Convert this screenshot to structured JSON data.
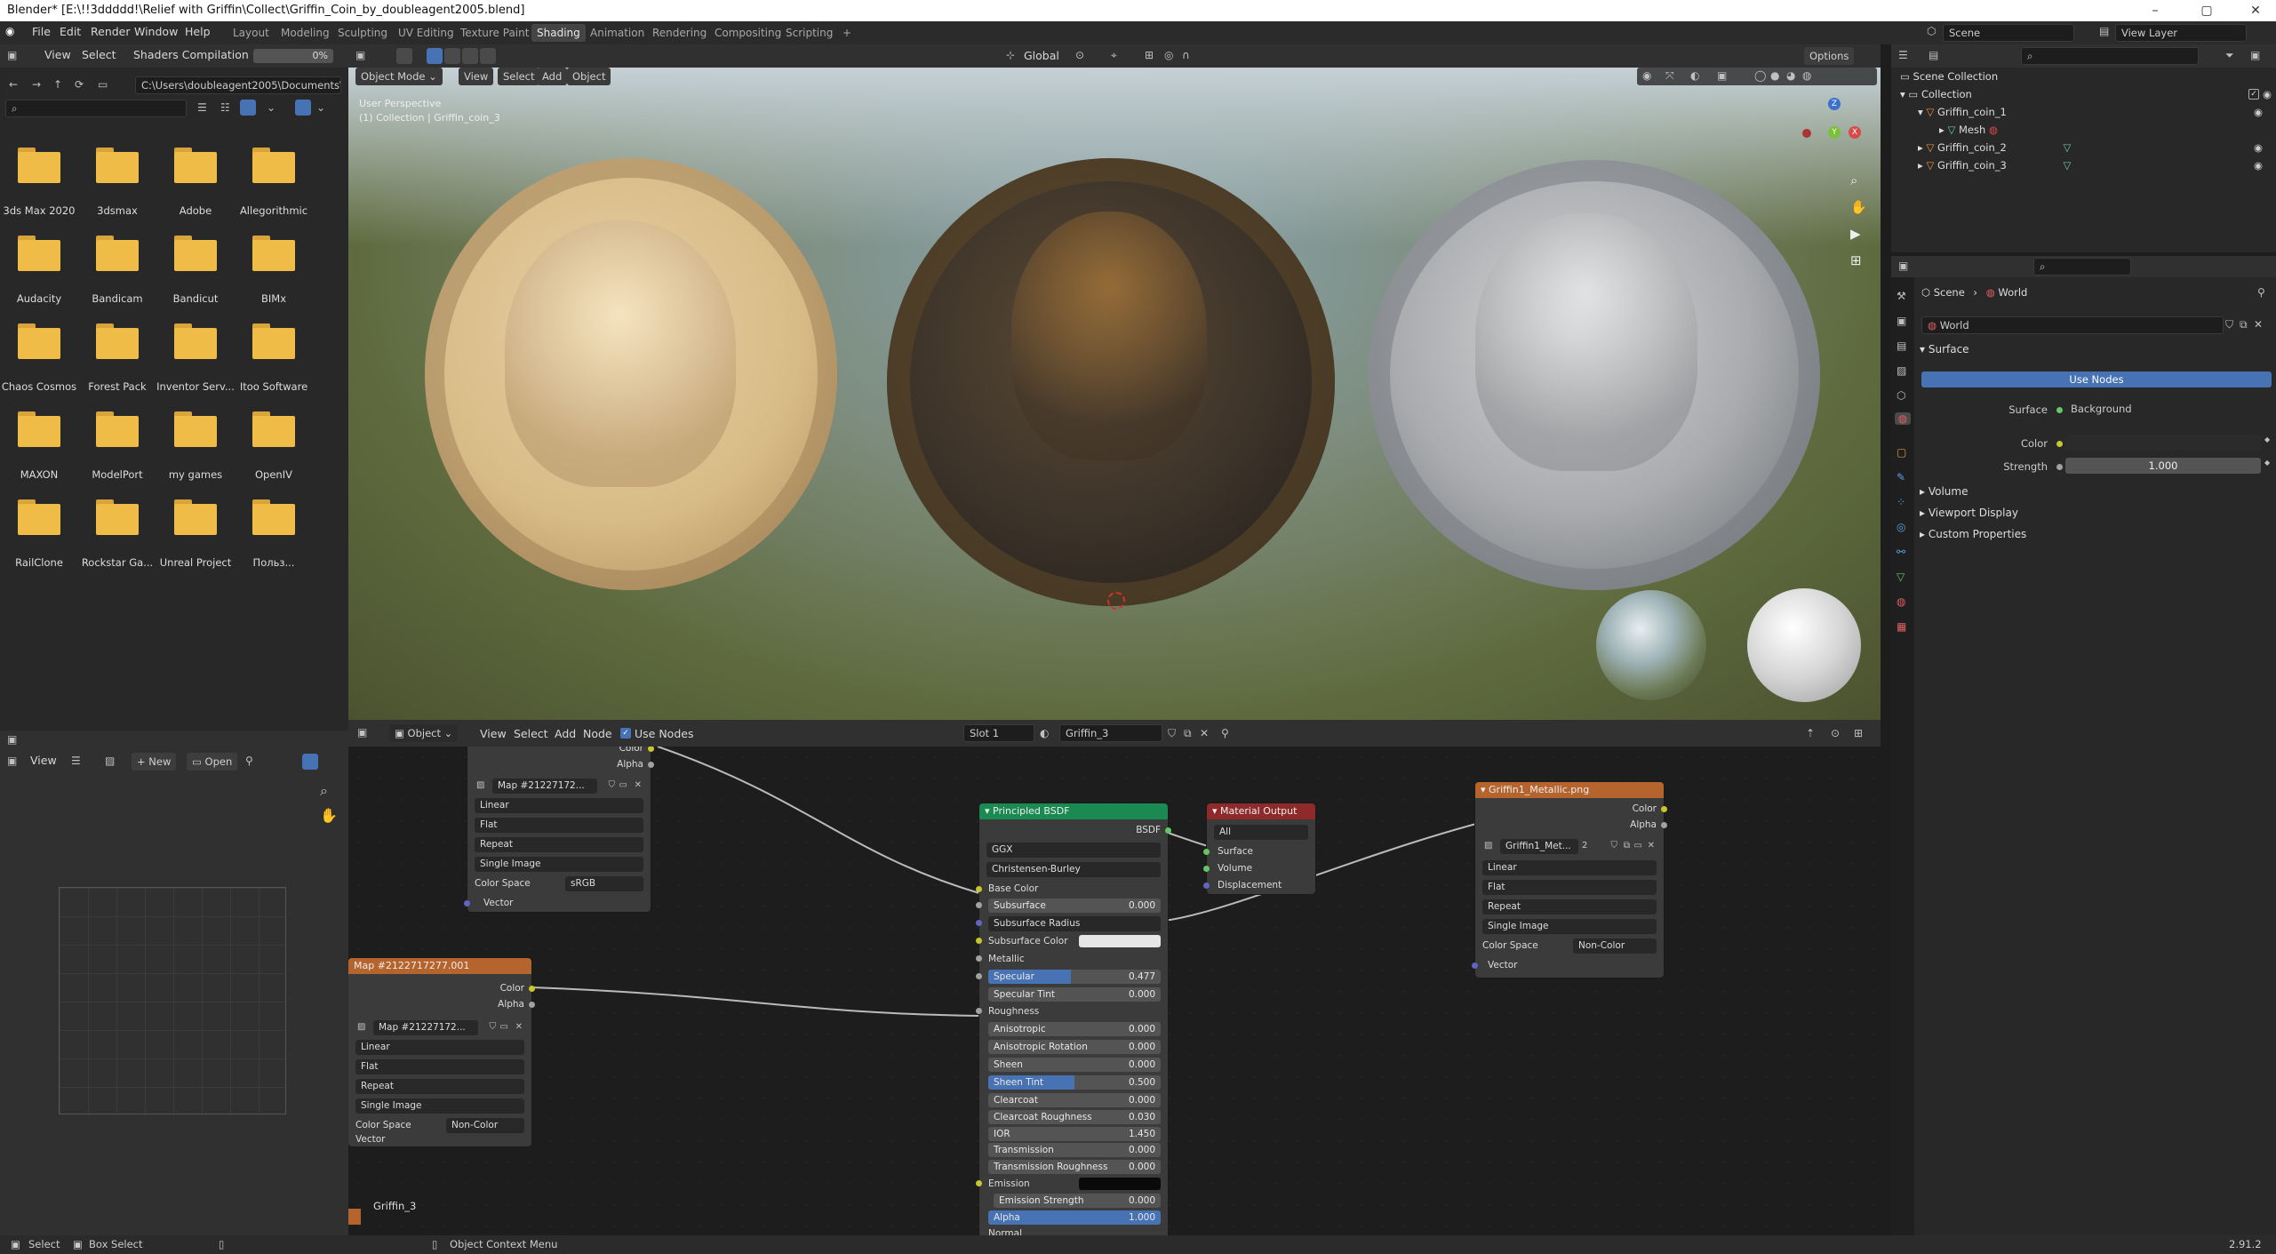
{
  "window": {
    "title": "Blender* [E:\\!!3ddddd!\\Relief with Griffin\\Collect\\Griffin_Coin_by_doubleagent2005.blend]",
    "minimize": "–",
    "maximize": "▢",
    "close": "✕"
  },
  "menubar": {
    "items": [
      "File",
      "Edit",
      "Render",
      "Window",
      "Help"
    ]
  },
  "workspaces": {
    "tabs": [
      "Layout",
      "Modeling",
      "Sculpting",
      "UV Editing",
      "Texture Paint",
      "Shading",
      "Animation",
      "Rendering",
      "Compositing",
      "Scripting"
    ],
    "active": "Shading",
    "add": "+"
  },
  "scene": {
    "name": "Scene",
    "view_layer": "View Layer"
  },
  "filebrowser": {
    "menus": [
      "View",
      "Select"
    ],
    "title": "Shaders Compilation",
    "progress_text": "0%",
    "progress": 0,
    "path": "C:\\Users\\doubleagent2005\\Documents\\",
    "folders": [
      "3ds Max 2020",
      "3dsmax",
      "Adobe",
      "Allegorithmic",
      "Audacity",
      "Bandicam",
      "Bandicut",
      "BIMx",
      "Chaos Cosmos",
      "Forest Pack",
      "Inventor Serv...",
      "Itoo Software",
      "MAXON",
      "ModelPort",
      "my games",
      "OpenIV",
      "RailClone",
      "Rockstar Ga...",
      "Unreal Project",
      "Польз..."
    ]
  },
  "viewport": {
    "mode": "Object Mode",
    "menus": [
      "View",
      "Select",
      "Add",
      "Object"
    ],
    "transform": "Global",
    "overlay_text1": "User Perspective",
    "overlay_text2": "(1) Collection | Griffin_coin_3",
    "options": "Options",
    "gizmo": {
      "x": "X",
      "y": "Y",
      "z": "Z"
    }
  },
  "image_editor": {
    "view": "View",
    "new": "New",
    "open": "Open"
  },
  "node_editor": {
    "type": "Object",
    "menus": [
      "View",
      "Select",
      "Add",
      "Node"
    ],
    "use_nodes": "Use Nodes",
    "slot": "Slot 1",
    "material": "Griffin_3",
    "footer_label": "Griffin_3",
    "node_map1": {
      "outputs": [
        "Color",
        "Alpha"
      ],
      "image": "Map #21227172...",
      "interp": "Linear",
      "proj": "Flat",
      "ext": "Repeat",
      "source": "Single Image",
      "cs_label": "Color Space",
      "cs": "sRGB",
      "vector": "Vector"
    },
    "node_map2": {
      "title": "Map #2122717277.001",
      "outputs": [
        "Color",
        "Alpha"
      ],
      "image": "Map #21227172...",
      "interp": "Linear",
      "proj": "Flat",
      "ext": "Repeat",
      "source": "Single Image",
      "cs_label": "Color Space",
      "cs": "Non-Color",
      "vector": "Vector"
    },
    "bsdf": {
      "title": "Principled BSDF",
      "output": "BSDF",
      "dist": "GGX",
      "ss_method": "Christensen-Burley",
      "base_color": "Base Color",
      "subsurface": {
        "label": "Subsurface",
        "value": "0.000"
      },
      "ss_radius": "Subsurface Radius",
      "ss_color": "Subsurface Color",
      "metallic": "Metallic",
      "specular": {
        "label": "Specular",
        "value": "0.477",
        "fill": 0.477
      },
      "spec_tint": {
        "label": "Specular Tint",
        "value": "0.000"
      },
      "roughness": "Roughness",
      "aniso": {
        "label": "Anisotropic",
        "value": "0.000"
      },
      "aniso_rot": {
        "label": "Anisotropic Rotation",
        "value": "0.000"
      },
      "sheen": {
        "label": "Sheen",
        "value": "0.000"
      },
      "sheen_tint": {
        "label": "Sheen Tint",
        "value": "0.500",
        "fill": 0.5
      },
      "clearcoat": {
        "label": "Clearcoat",
        "value": "0.000"
      },
      "cc_rough": {
        "label": "Clearcoat Roughness",
        "value": "0.030"
      },
      "ior": {
        "label": "IOR",
        "value": "1.450"
      },
      "transmission": {
        "label": "Transmission",
        "value": "0.000"
      },
      "trans_rough": {
        "label": "Transmission Roughness",
        "value": "0.000"
      },
      "emission": "Emission",
      "em_strength": {
        "label": "Emission Strength",
        "value": "0.000"
      },
      "alpha": {
        "label": "Alpha",
        "value": "1.000",
        "fill": 1
      },
      "normal": "Normal"
    },
    "mat_out": {
      "title": "Material Output",
      "target": "All",
      "inputs": [
        "Surface",
        "Volume",
        "Displacement"
      ]
    },
    "metal": {
      "title": "Griffin1_Metallic.png",
      "outputs": [
        "Color",
        "Alpha"
      ],
      "image": "Griffin1_Met...",
      "users": "2",
      "interp": "Linear",
      "proj": "Flat",
      "ext": "Repeat",
      "source": "Single Image",
      "cs_label": "Color Space",
      "cs": "Non-Color",
      "vector": "Vector"
    }
  },
  "outliner": {
    "root": "Scene Collection",
    "collection": "Collection",
    "items": [
      "Griffin_coin_1",
      "Mesh",
      "Griffin_coin_2",
      "Griffin_coin_3"
    ]
  },
  "properties": {
    "breadcrumb": [
      "Scene",
      "World"
    ],
    "world_name": "World",
    "surface_header": "Surface",
    "use_nodes": "Use Nodes",
    "surface_label": "Surface",
    "surface_value": "Background",
    "color_label": "Color",
    "strength_label": "Strength",
    "strength_value": "1.000",
    "sections": [
      "Volume",
      "Viewport Display",
      "Custom Properties"
    ]
  },
  "statusbar": {
    "select": "Select",
    "box_select": "Box Select",
    "context": "Object Context Menu",
    "version": "2.91.2"
  },
  "colors": {
    "accent": "#4772b3",
    "node_green": "#1a8a52",
    "node_red": "#8e2a2a",
    "node_orange": "#b5642d"
  }
}
